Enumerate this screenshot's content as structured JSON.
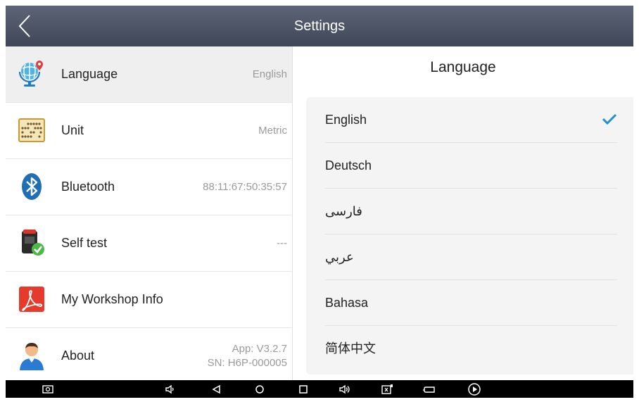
{
  "header": {
    "title": "Settings"
  },
  "settings": {
    "items": [
      {
        "label": "Language",
        "value": "English",
        "icon": "globe-pin-icon"
      },
      {
        "label": "Unit",
        "value": "Metric",
        "icon": "abacus-icon"
      },
      {
        "label": "Bluetooth",
        "value": "88:11:67:50:35:57",
        "icon": "bluetooth-icon"
      },
      {
        "label": "Self test",
        "value": "---",
        "icon": "device-check-icon"
      },
      {
        "label": "My Workshop Info",
        "value": "",
        "icon": "pdf-icon"
      },
      {
        "label": "About",
        "value": "App: V3.2.7",
        "value2": "SN: H6P-000005",
        "icon": "user-icon"
      }
    ]
  },
  "language_panel": {
    "title": "Language",
    "selected": "English",
    "options": [
      "English",
      "Deutsch",
      "فارسی",
      "عربي",
      "Bahasa",
      "简体中文"
    ]
  },
  "colors": {
    "titlebar": "#4a5163",
    "check": "#1e8fd8",
    "selected_row": "#efefef"
  }
}
